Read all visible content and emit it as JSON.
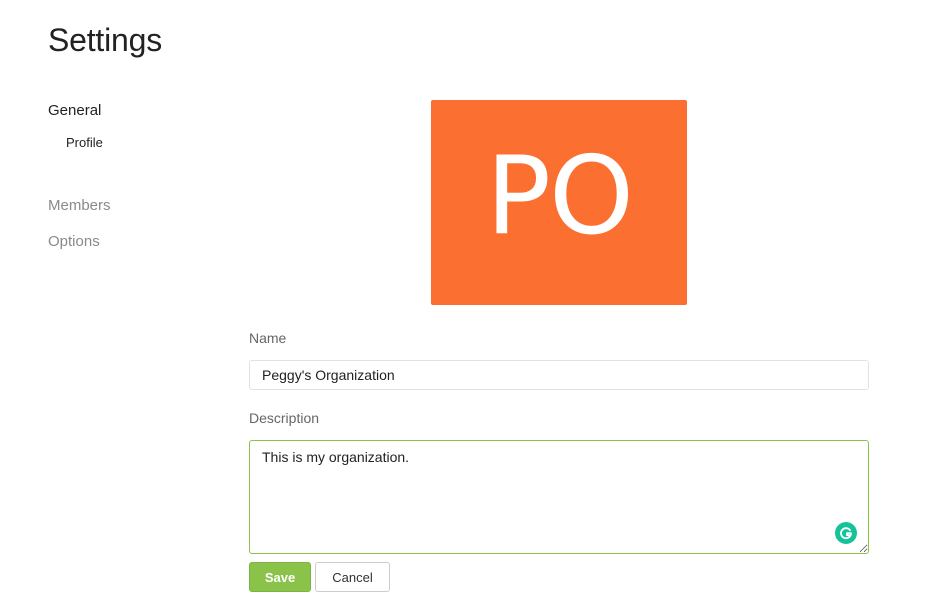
{
  "page": {
    "title": "Settings"
  },
  "sidebar": {
    "items": [
      {
        "label": "General",
        "state": "active"
      },
      {
        "label": "Profile",
        "state": "sub-active"
      },
      {
        "label": "Members",
        "state": "inactive"
      },
      {
        "label": "Options",
        "state": "inactive"
      }
    ]
  },
  "avatar": {
    "initials": "PO",
    "color": "#fb6f31"
  },
  "form": {
    "name_label": "Name",
    "name_value": "Peggy's Organization",
    "description_label": "Description",
    "description_value": "This is my organization. ",
    "save_label": "Save",
    "cancel_label": "Cancel"
  },
  "colors": {
    "accent": "#8bc34a",
    "grammarly": "#15c39a"
  },
  "icons": {
    "grammarly": "grammarly-g-icon"
  }
}
